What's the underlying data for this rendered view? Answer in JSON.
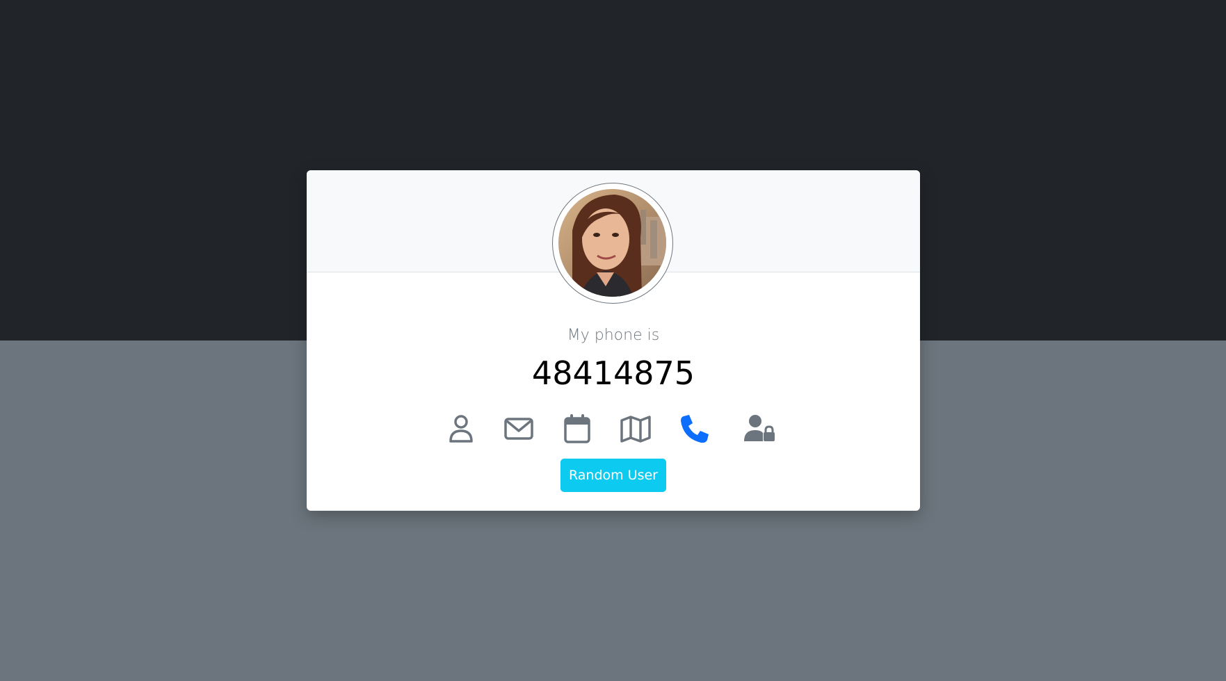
{
  "profile": {
    "label": "My phone is",
    "value": "48414875"
  },
  "icons": [
    {
      "name": "user-icon",
      "active": false
    },
    {
      "name": "envelope-icon",
      "active": false
    },
    {
      "name": "calendar-icon",
      "active": false
    },
    {
      "name": "map-icon",
      "active": false
    },
    {
      "name": "phone-icon",
      "active": true
    },
    {
      "name": "user-lock-icon",
      "active": false
    }
  ],
  "actions": {
    "random_user_label": "Random User"
  },
  "colors": {
    "top_background": "#212529",
    "bottom_background": "#6c757d",
    "icon_default": "#6c757d",
    "icon_active": "#0d6efd",
    "button": "#0dcaf0"
  }
}
